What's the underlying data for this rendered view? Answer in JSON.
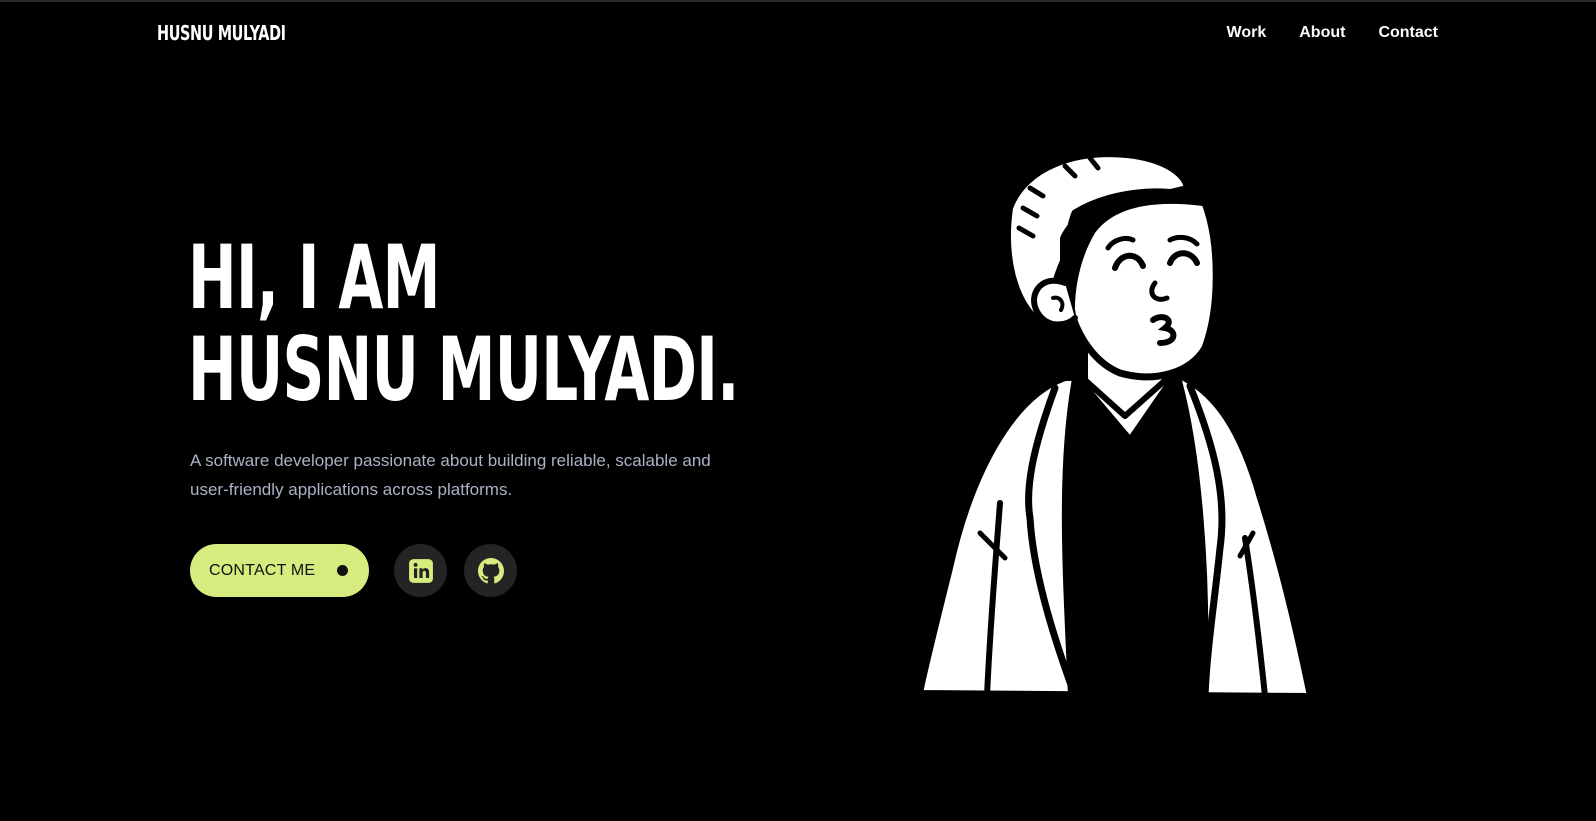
{
  "header": {
    "brand": "HUSNU MULYADI",
    "nav": [
      {
        "label": "Work"
      },
      {
        "label": "About"
      },
      {
        "label": "Contact"
      }
    ]
  },
  "hero": {
    "title_line1": "HI, I AM",
    "title_line2": "HUSNU MULYADI.",
    "description": "A software developer passionate about building reliable, scalable and user-friendly applications across platforms.",
    "contact_label": "CONTACT ME",
    "social": [
      {
        "icon": "linkedin-icon"
      },
      {
        "icon": "github-icon"
      }
    ]
  },
  "colors": {
    "background": "#000000",
    "accent": "#d6ec7e",
    "text": "#ffffff",
    "muted_text": "#a9b3c4",
    "social_bg": "#242424"
  },
  "illustration": {
    "icon": "developer-avatar-illustration"
  }
}
